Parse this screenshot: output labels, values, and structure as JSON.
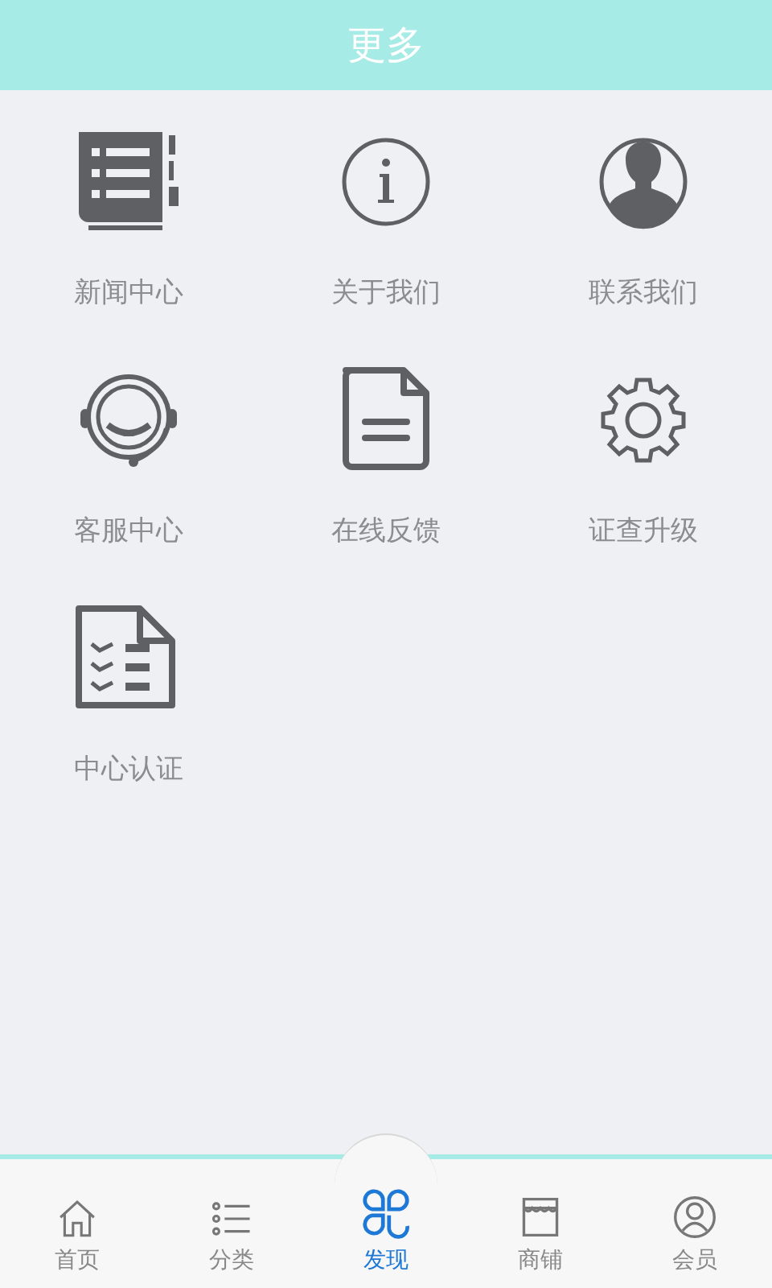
{
  "header": {
    "title": "更多"
  },
  "items": [
    {
      "label": "新闻中心",
      "kind": "book"
    },
    {
      "label": "关于我们",
      "kind": "info"
    },
    {
      "label": "联系我们",
      "kind": "person"
    },
    {
      "label": "客服中心",
      "kind": "headset"
    },
    {
      "label": "在线反馈",
      "kind": "document"
    },
    {
      "label": "证查升级",
      "kind": "gear"
    },
    {
      "label": "中心认证",
      "kind": "checklist"
    }
  ],
  "tabbar": [
    {
      "label": "首页",
      "kind": "home",
      "selected": false
    },
    {
      "label": "分类",
      "kind": "list",
      "selected": false
    },
    {
      "label": "发现",
      "kind": "clover",
      "selected": true
    },
    {
      "label": "商铺",
      "kind": "shop",
      "selected": false
    },
    {
      "label": "会员",
      "kind": "member",
      "selected": false
    }
  ]
}
